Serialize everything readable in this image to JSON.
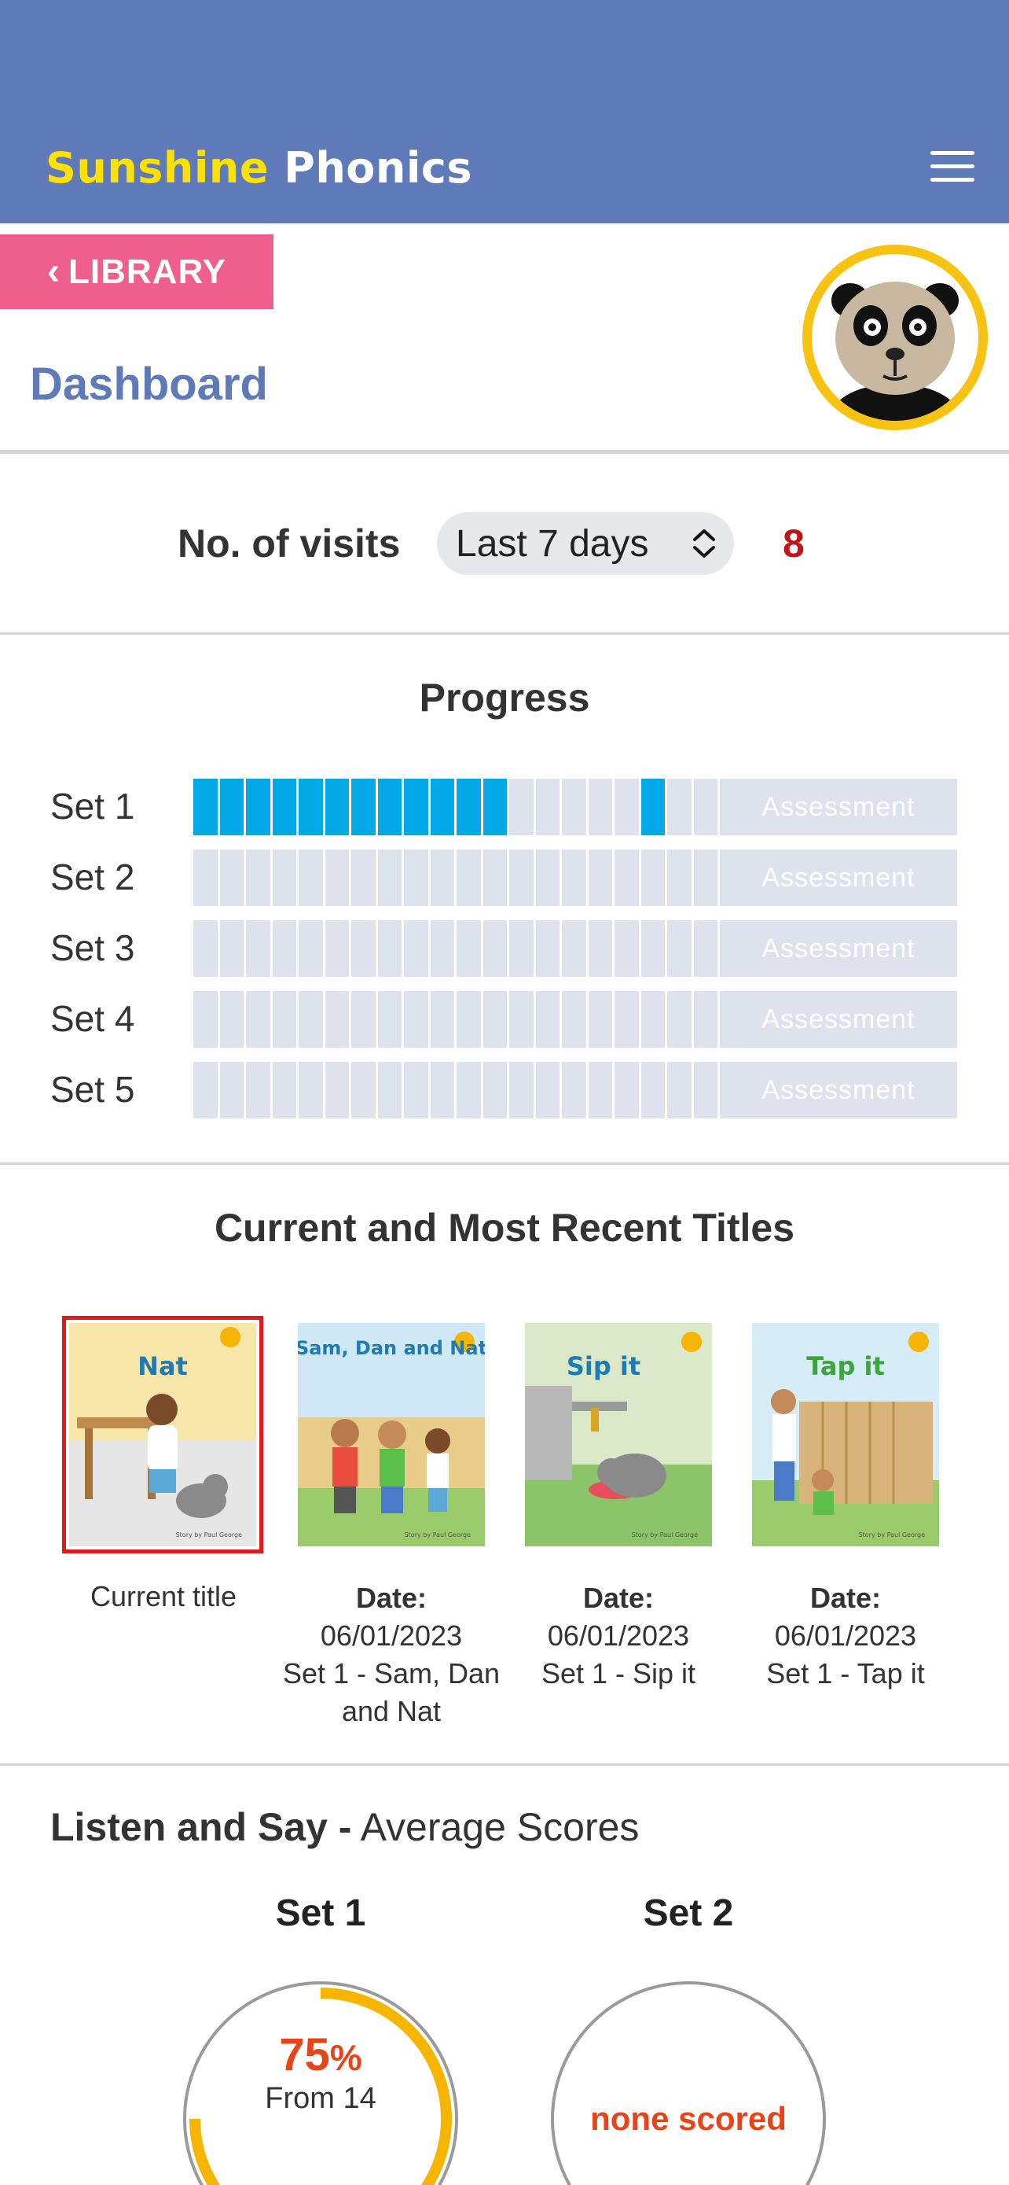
{
  "header": {
    "brand_part1": "Sunshine",
    "brand_part2": "Phonics"
  },
  "nav": {
    "library_label": "LIBRARY"
  },
  "page": {
    "title": "Dashboard"
  },
  "visits": {
    "label": "No. of visits",
    "period": "Last 7 days",
    "count": "8"
  },
  "progress": {
    "title": "Progress",
    "segments_per_set": 20,
    "completed_color": "#03a9e6",
    "empty_color": "#dde2ec",
    "sets": [
      {
        "label": "Set 1",
        "assessment": "Assessment",
        "completed": [
          0,
          1,
          2,
          3,
          4,
          5,
          6,
          7,
          8,
          9,
          10,
          11,
          17
        ]
      },
      {
        "label": "Set 2",
        "assessment": "Assessment",
        "completed": []
      },
      {
        "label": "Set 3",
        "assessment": "Assessment",
        "completed": []
      },
      {
        "label": "Set 4",
        "assessment": "Assessment",
        "completed": []
      },
      {
        "label": "Set 5",
        "assessment": "Assessment",
        "completed": []
      }
    ]
  },
  "recent": {
    "title": "Current and Most Recent Titles",
    "books": [
      {
        "cover_title": "Nat",
        "author": "Story by Paul George",
        "caption": "Current title"
      },
      {
        "cover_title": "Sam, Dan and Nat",
        "author": "Story by Paul George",
        "date_label": "Date:",
        "date": "06/01/2023",
        "set_title": "Set 1 - Sam, Dan and Nat"
      },
      {
        "cover_title": "Sip it",
        "author": "Story by Paul George",
        "date_label": "Date:",
        "date": "06/01/2023",
        "set_title": "Set 1 - Sip it"
      },
      {
        "cover_title": "Tap it",
        "author": "Story by Paul George",
        "date_label": "Date:",
        "date": "06/01/2023",
        "set_title": "Set 1 - Tap it"
      }
    ]
  },
  "listen_say": {
    "title_bold": "Listen and Say -",
    "title_rest": "Average Scores",
    "sets": [
      {
        "label": "Set 1",
        "score_value": "75",
        "score_unit": "%",
        "score_from": "From 14",
        "fraction": 0.75
      },
      {
        "label": "Set 2",
        "score_text": "none scored"
      }
    ],
    "accent_color": "#f7b500"
  }
}
